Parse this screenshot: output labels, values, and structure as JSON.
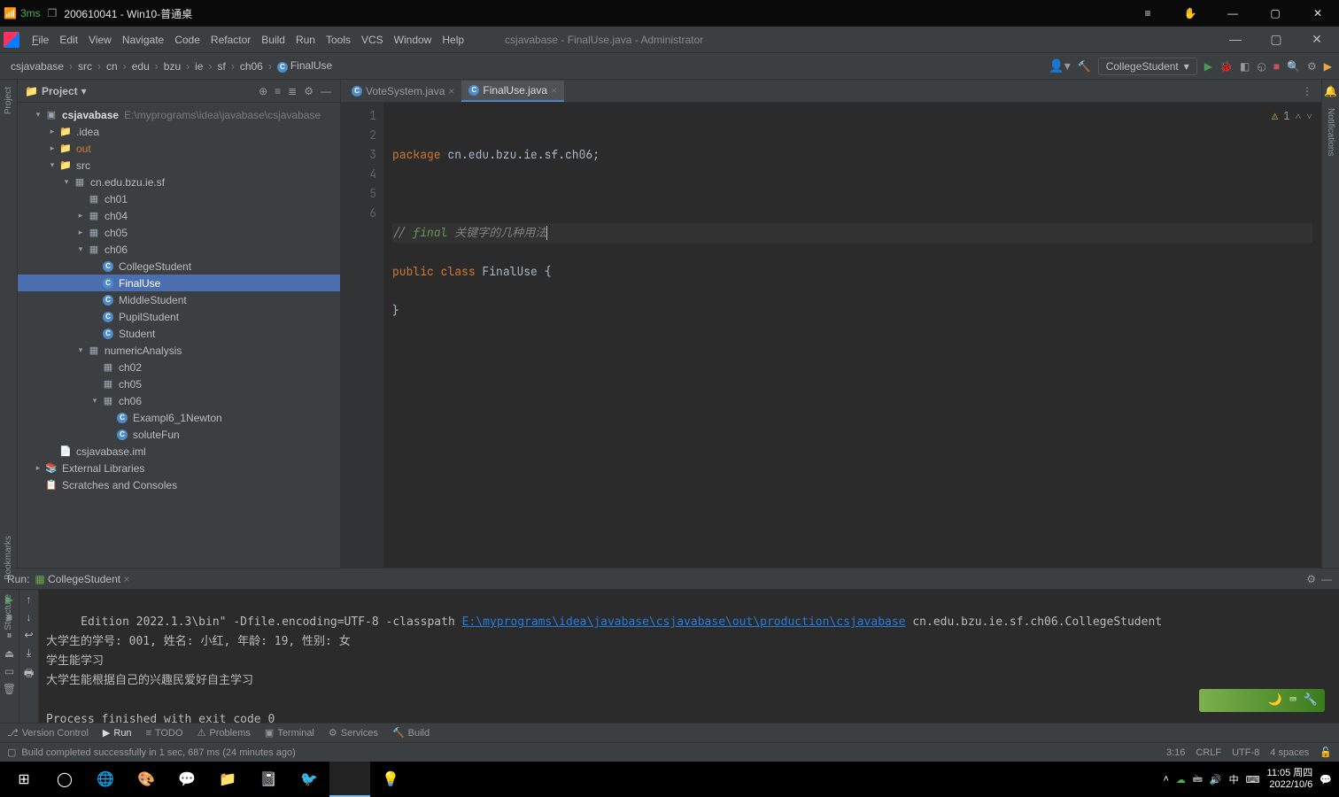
{
  "win_title": {
    "ping": "3ms",
    "text": "200610041 - Win10-普通桌"
  },
  "ide": {
    "menus": {
      "file": "File",
      "edit": "Edit",
      "view": "View",
      "navigate": "Navigate",
      "code": "Code",
      "refactor": "Refactor",
      "build": "Build",
      "run": "Run",
      "tools": "Tools",
      "vcs": "VCS",
      "window": "Window",
      "help": "Help"
    },
    "context": "csjavabase - FinalUse.java - Administrator"
  },
  "breadcrumbs": [
    "csjavabase",
    "src",
    "cn",
    "edu",
    "bzu",
    "ie",
    "sf",
    "ch06",
    "FinalUse"
  ],
  "run_config": "CollegeStudent",
  "project": {
    "title": "Project",
    "root": {
      "name": "csjavabase",
      "path": "E:\\myprograms\\idea\\javabase\\csjavabase"
    },
    "nodes": {
      "idea": ".idea",
      "out": "out",
      "src": "src",
      "pkg": "cn.edu.bzu.ie.sf",
      "ch01": "ch01",
      "ch04": "ch04",
      "ch05": "ch05",
      "ch06": "ch06",
      "college": "CollegeStudent",
      "finaluse": "FinalUse",
      "middle": "MiddleStudent",
      "pupil": "PupilStudent",
      "student": "Student",
      "numeric": "numericAnalysis",
      "na_ch02": "ch02",
      "na_ch05": "ch05",
      "na_ch06": "ch06",
      "newton": "Exampl6_1Newton",
      "solute": "soluteFun",
      "iml": "csjavabase.iml",
      "external": "External Libraries",
      "scratch": "Scratches and Consoles"
    }
  },
  "tabs": {
    "vote": "VoteSystem.java",
    "final": "FinalUse.java"
  },
  "editor": {
    "lines": [
      "1",
      "2",
      "3",
      "4",
      "5",
      "6"
    ],
    "l1_kw": "package",
    "l1_pkg": " cn.edu.bzu.ie.sf.ch06;",
    "l3_prefix": "// ",
    "l3_kw": "final",
    "l3_rest": " 关键字的几种用法",
    "l4_kw1": "public",
    "l4_kw2": "class",
    "l4_cls": "FinalUse",
    "l4_brace": " {",
    "l5": "}",
    "warn_count": "1"
  },
  "run": {
    "label": "Run:",
    "config_name": "CollegeStudent",
    "out_top_prefix": "     Edition 2022.1.3\\bin\" -Dfile.encoding=UTF-8 -classpath ",
    "out_top_path": "E:\\myprograms\\idea\\javabase\\csjavabase\\out\\production\\csjavabase",
    "out_top_suffix": " cn.edu.bzu.ie.sf.ch06.CollegeStudent",
    "line1": "大学生的学号: 001, 姓名: 小红, 年龄: 19, 性别: 女",
    "line2": "学生能学习",
    "line3": "大学生能根据自己的兴趣民爱好自主学习",
    "exit": "Process finished with exit code 0"
  },
  "tools": {
    "version": "Version Control",
    "run": "Run",
    "todo": "TODO",
    "problems": "Problems",
    "terminal": "Terminal",
    "services": "Services",
    "build": "Build"
  },
  "status": {
    "msg": "Build completed successfully in 1 sec, 687 ms (24 minutes ago)",
    "pos": "3:16",
    "crlf": "CRLF",
    "encoding": "UTF-8",
    "indent": "4 spaces"
  },
  "taskbar": {
    "clock_time": "11:05",
    "clock_day": "周四",
    "clock_date": "2022/10/6",
    "ime": "中"
  },
  "sidebar": {
    "project": "Project",
    "bookmarks": "Bookmarks",
    "structure": "Structure",
    "notifications": "Notifications"
  }
}
